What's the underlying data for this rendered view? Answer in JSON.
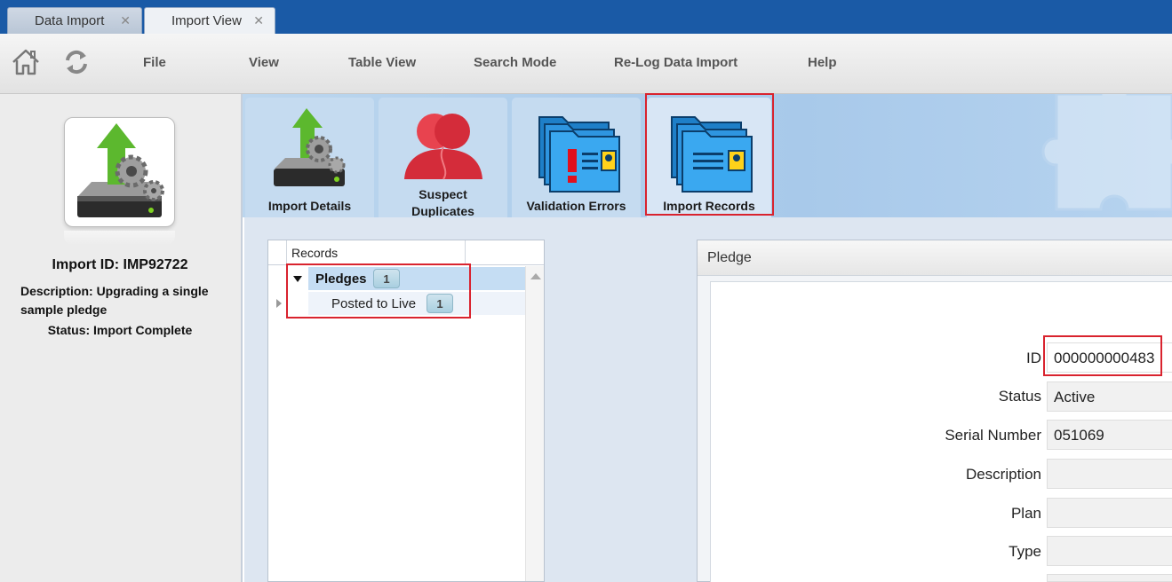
{
  "tabs": [
    {
      "label": "Data Import",
      "close": "✕"
    },
    {
      "label": "Import View",
      "close": "✕"
    }
  ],
  "toolbar": {
    "icons": [
      "home-icon",
      "refresh-icon"
    ],
    "menu": [
      "File",
      "View",
      "Table View",
      "Search Mode",
      "Re-Log Data Import",
      "Help"
    ]
  },
  "import_info": {
    "id_label": "Import ID: IMP92722",
    "description": "Description: Upgrading a single sample pledge",
    "status": "Status: Import Complete"
  },
  "ribbon": {
    "buttons": [
      {
        "label": "Import Details",
        "icon": "import-details-icon"
      },
      {
        "label_line1": "Suspect",
        "label_line2": "Duplicates",
        "icon": "suspect-duplicates-icon"
      },
      {
        "label": "Validation Errors",
        "icon": "validation-errors-icon"
      },
      {
        "label": "Import Records",
        "icon": "import-records-icon"
      }
    ]
  },
  "records": {
    "header": "Records",
    "rows": [
      {
        "label": "Pledges",
        "count": "1"
      },
      {
        "label": "Posted to Live",
        "count": "1"
      }
    ]
  },
  "pledge": {
    "title": "Pledge",
    "fields": [
      {
        "label": "ID",
        "value": "000000000483"
      },
      {
        "label": "Status",
        "value": "Active"
      },
      {
        "label": "Serial Number",
        "value": "051069"
      },
      {
        "label": "Description",
        "value": ""
      },
      {
        "label": "Plan",
        "value": ""
      },
      {
        "label": "Type",
        "value": ""
      }
    ]
  },
  "colors": {
    "title_bar": "#1a5aa6",
    "highlight": "#d9232e",
    "ribbon": "#a8c9ea"
  }
}
